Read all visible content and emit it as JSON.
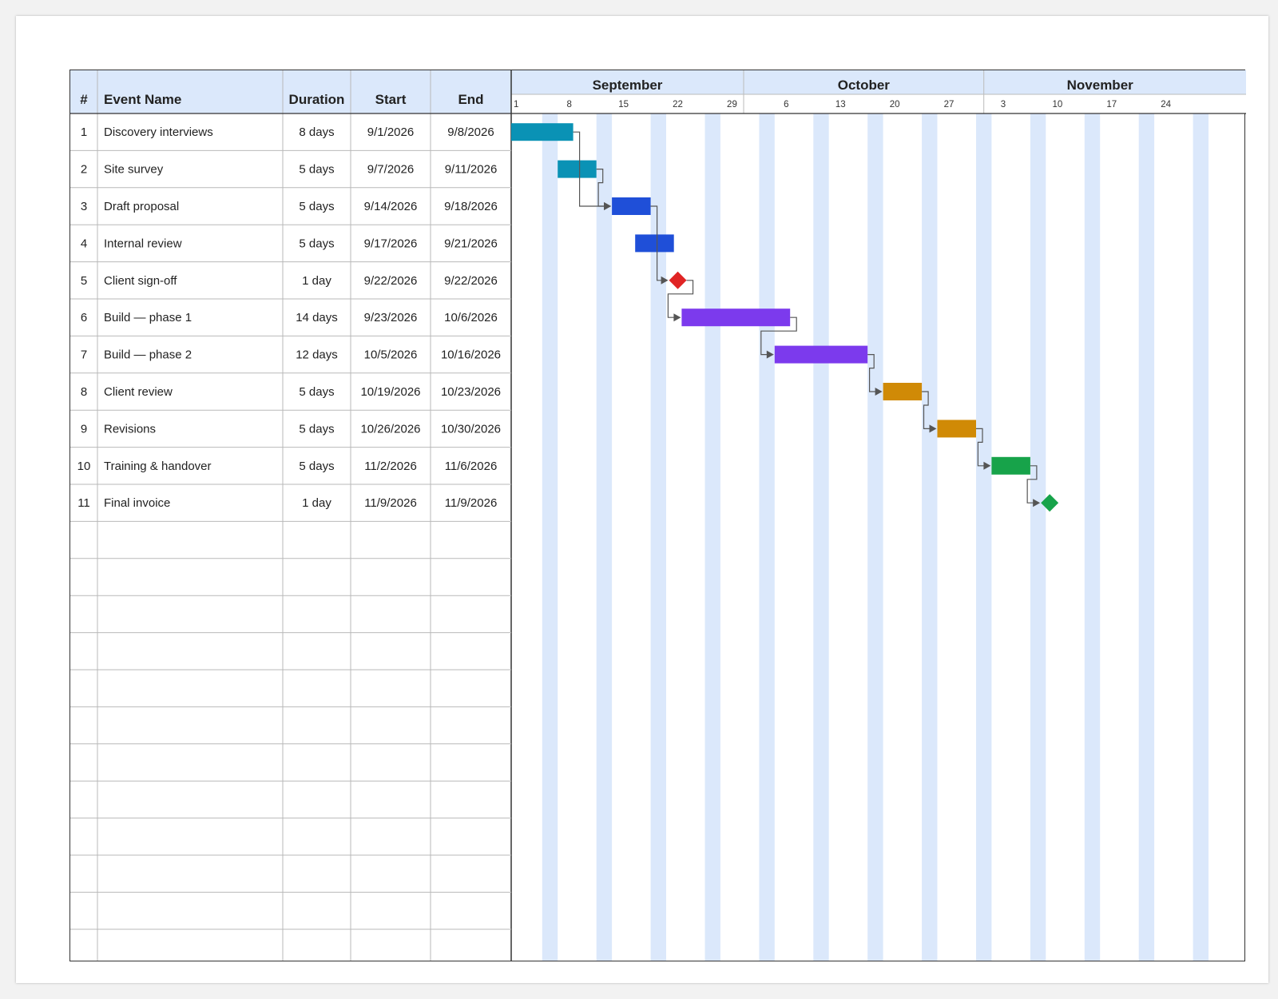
{
  "table": {
    "headers": {
      "num": "#",
      "name": "Event Name",
      "duration": "Duration",
      "start": "Start",
      "end": "End"
    }
  },
  "chart_data": {
    "type": "gantt",
    "year": 2026,
    "months": [
      {
        "name": "September",
        "days": 30
      },
      {
        "name": "October",
        "days": 31
      },
      {
        "name": "November",
        "days": 30
      }
    ],
    "week_ticks": [
      "1",
      "8",
      "15",
      "22",
      "29",
      "6",
      "13",
      "20",
      "27",
      "3",
      "10",
      "17",
      "24"
    ],
    "weekend_shading": true,
    "tasks": [
      {
        "num": "1",
        "name": "Discovery interviews",
        "duration": "8 days",
        "start": "9/1/2026",
        "end": "9/8/2026",
        "type": "bar",
        "color": "#0a92b5",
        "pred": null
      },
      {
        "num": "2",
        "name": "Site survey",
        "duration": "5 days",
        "start": "9/7/2026",
        "end": "9/11/2026",
        "type": "bar",
        "color": "#0a92b5",
        "pred": null
      },
      {
        "num": "3",
        "name": "Draft proposal",
        "duration": "5 days",
        "start": "9/14/2026",
        "end": "9/18/2026",
        "type": "bar",
        "color": "#1f4fd8",
        "pred": [
          1,
          2
        ]
      },
      {
        "num": "4",
        "name": "Internal review",
        "duration": "5 days",
        "start": "9/17/2026",
        "end": "9/21/2026",
        "type": "bar",
        "color": "#1f4fd8",
        "pred": null
      },
      {
        "num": "5",
        "name": "Client sign-off",
        "duration": "1 day",
        "start": "9/22/2026",
        "end": "9/22/2026",
        "type": "milestone",
        "color": "#e02424",
        "pred": [
          3
        ]
      },
      {
        "num": "6",
        "name": "Build — phase 1",
        "duration": "14 days",
        "start": "9/23/2026",
        "end": "10/6/2026",
        "type": "bar",
        "color": "#7c3aed",
        "pred": [
          5
        ]
      },
      {
        "num": "7",
        "name": "Build — phase 2",
        "duration": "12 days",
        "start": "10/5/2026",
        "end": "10/16/2026",
        "type": "bar",
        "color": "#7c3aed",
        "pred": [
          6
        ]
      },
      {
        "num": "8",
        "name": "Client review",
        "duration": "5 days",
        "start": "10/19/2026",
        "end": "10/23/2026",
        "type": "bar",
        "color": "#d08a06",
        "pred": [
          7
        ]
      },
      {
        "num": "9",
        "name": "Revisions",
        "duration": "5 days",
        "start": "10/26/2026",
        "end": "10/30/2026",
        "type": "bar",
        "color": "#d08a06",
        "pred": [
          8
        ]
      },
      {
        "num": "10",
        "name": "Training & handover",
        "duration": "5 days",
        "start": "11/2/2026",
        "end": "11/6/2026",
        "type": "bar",
        "color": "#17a34a",
        "pred": [
          9
        ]
      },
      {
        "num": "11",
        "name": "Final invoice",
        "duration": "1 day",
        "start": "11/9/2026",
        "end": "11/9/2026",
        "type": "milestone",
        "color": "#17a34a",
        "pred": [
          10
        ]
      }
    ]
  }
}
